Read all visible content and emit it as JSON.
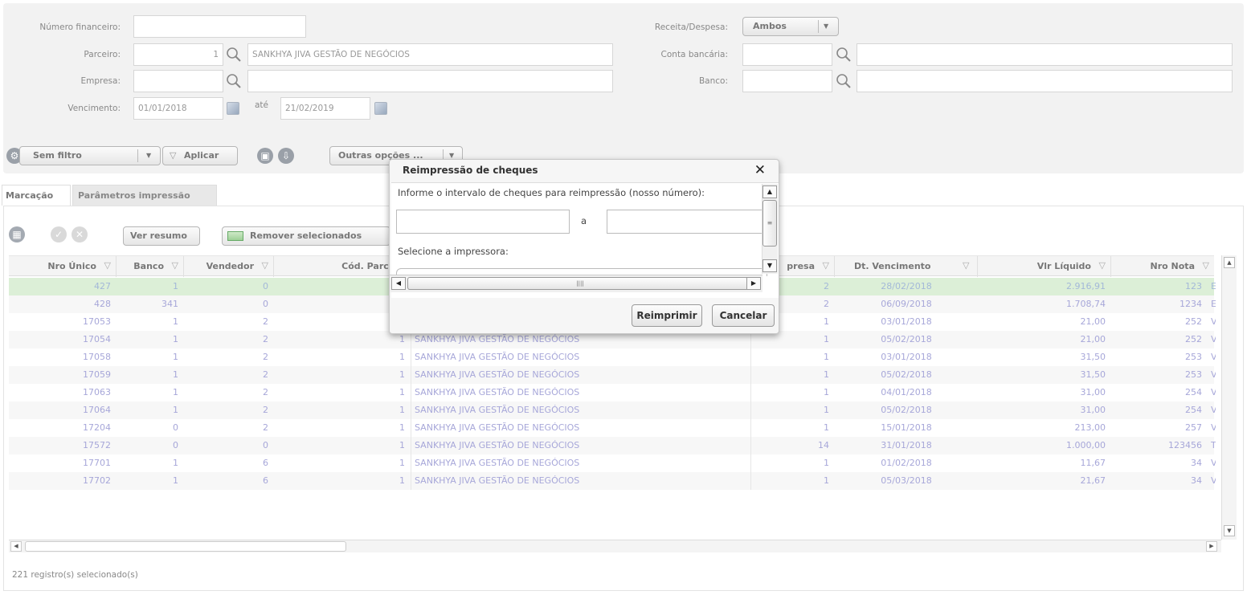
{
  "filters": {
    "numero_financeiro_label": "Número financeiro:",
    "numero_financeiro_value": "",
    "parceiro_label": "Parceiro:",
    "parceiro_code": "1",
    "parceiro_name": "SANKHYA JIVA GESTÃO DE NEGÓCIOS",
    "empresa_label": "Empresa:",
    "vencimento_label": "Vencimento:",
    "vencimento_from": "01/01/2018",
    "ate_label": "até",
    "vencimento_to": "21/02/2019",
    "receita_label": "Receita/Despesa:",
    "receita_value": "Ambos",
    "conta_label": "Conta bancária:",
    "banco_label": "Banco:"
  },
  "toolbar": {
    "sem_filtro": "Sem filtro",
    "aplicar": "Aplicar",
    "outras_opcoes": "Outras opções ..."
  },
  "tabs": [
    "Marcação",
    "Parâmetros impressão"
  ],
  "grid_toolbar": {
    "ver_resumo": "Ver resumo",
    "remover_selecionados": "Remover selecionados"
  },
  "grid": {
    "headers": {
      "nro_unico": "Nro Único",
      "banco": "Banco",
      "vendedor": "Vendedor",
      "cod_parceiro": "Cód. Parceiro",
      "empresa": "presa",
      "dt_vencimento": "Dt. Vencimento",
      "vlr_liquido": "Vlr Líquido",
      "nro_nota": "Nro Nota"
    },
    "rows": [
      {
        "nro": "427",
        "banco": "1",
        "vend": "0",
        "cod": "",
        "parc": "",
        "emp": "2",
        "dt": "28/02/2018",
        "vlr": "2.916,91",
        "nota": "123",
        "x": "E"
      },
      {
        "nro": "428",
        "banco": "341",
        "vend": "0",
        "cod": "",
        "parc": "",
        "emp": "2",
        "dt": "06/09/2018",
        "vlr": "1.708,74",
        "nota": "1234",
        "x": "E"
      },
      {
        "nro": "17053",
        "banco": "1",
        "vend": "2",
        "cod": "",
        "parc": "",
        "emp": "1",
        "dt": "03/01/2018",
        "vlr": "21,00",
        "nota": "252",
        "x": "V"
      },
      {
        "nro": "17054",
        "banco": "1",
        "vend": "2",
        "cod": "1",
        "parc": "SANKHYA JIVA GESTÃO DE NEGÓCIOS",
        "emp": "1",
        "dt": "05/02/2018",
        "vlr": "21,00",
        "nota": "252",
        "x": "V"
      },
      {
        "nro": "17058",
        "banco": "1",
        "vend": "2",
        "cod": "1",
        "parc": "SANKHYA JIVA GESTÃO DE NEGÓCIOS",
        "emp": "1",
        "dt": "03/01/2018",
        "vlr": "31,50",
        "nota": "253",
        "x": "V"
      },
      {
        "nro": "17059",
        "banco": "1",
        "vend": "2",
        "cod": "1",
        "parc": "SANKHYA JIVA GESTÃO DE NEGÓCIOS",
        "emp": "1",
        "dt": "05/02/2018",
        "vlr": "31,50",
        "nota": "253",
        "x": "V"
      },
      {
        "nro": "17063",
        "banco": "1",
        "vend": "2",
        "cod": "1",
        "parc": "SANKHYA JIVA GESTÃO DE NEGÓCIOS",
        "emp": "1",
        "dt": "04/01/2018",
        "vlr": "31,00",
        "nota": "254",
        "x": "V"
      },
      {
        "nro": "17064",
        "banco": "1",
        "vend": "2",
        "cod": "1",
        "parc": "SANKHYA JIVA GESTÃO DE NEGÓCIOS",
        "emp": "1",
        "dt": "05/02/2018",
        "vlr": "31,00",
        "nota": "254",
        "x": "V"
      },
      {
        "nro": "17204",
        "banco": "0",
        "vend": "2",
        "cod": "1",
        "parc": "SANKHYA JIVA GESTÃO DE NEGÓCIOS",
        "emp": "1",
        "dt": "15/01/2018",
        "vlr": "213,00",
        "nota": "257",
        "x": "V"
      },
      {
        "nro": "17572",
        "banco": "0",
        "vend": "0",
        "cod": "1",
        "parc": "SANKHYA JIVA GESTÃO DE NEGÓCIOS",
        "emp": "14",
        "dt": "31/01/2018",
        "vlr": "1.000,00",
        "nota": "123456",
        "x": "T"
      },
      {
        "nro": "17701",
        "banco": "1",
        "vend": "6",
        "cod": "1",
        "parc": "SANKHYA JIVA GESTÃO DE NEGÓCIOS",
        "emp": "1",
        "dt": "01/02/2018",
        "vlr": "11,67",
        "nota": "34",
        "x": "V"
      },
      {
        "nro": "17702",
        "banco": "1",
        "vend": "6",
        "cod": "1",
        "parc": "SANKHYA JIVA GESTÃO DE NEGÓCIOS",
        "emp": "1",
        "dt": "05/03/2018",
        "vlr": "21,67",
        "nota": "34",
        "x": "V"
      }
    ]
  },
  "footer": {
    "status": "221 registro(s) selecionado(s)"
  },
  "modal": {
    "title": "Reimpressão de cheques",
    "close": "✕",
    "instruction": "Informe o intervalo de cheques para reimpressão (nosso número):",
    "a_label": "a",
    "printer_label": "Selecione a impressora:",
    "reimprimir": "Reimprimir",
    "cancelar": "Cancelar"
  }
}
